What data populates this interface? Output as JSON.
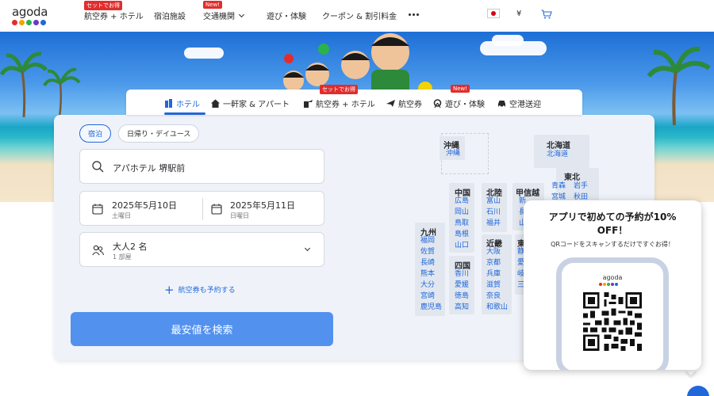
{
  "brand": {
    "logo_text": "agoda",
    "dot_colors": [
      "#e12d2d",
      "#f4a300",
      "#2bb24c",
      "#6f38c5",
      "#2067da"
    ]
  },
  "topnav": {
    "items": [
      {
        "label": "航空券 + ホテル",
        "badge": "セットでお得"
      },
      {
        "label": "宿泊施設"
      },
      {
        "label": "交通機関",
        "badge": "New!"
      },
      {
        "label": "遊び・体験"
      },
      {
        "label": "クーポン & 割引料金"
      }
    ],
    "currency": "¥"
  },
  "tabs": {
    "items": [
      {
        "label": "ホテル"
      },
      {
        "label": "一軒家 & アパート"
      },
      {
        "label": "航空券 + ホテル",
        "badge": "セットでお得"
      },
      {
        "label": "航空券"
      },
      {
        "label": "遊び・体験",
        "badge": "New!"
      },
      {
        "label": "空港送迎"
      }
    ]
  },
  "search": {
    "stay_types": [
      "宿泊",
      "日帰り・デイユース"
    ],
    "destination": "アパホテル 堺駅前",
    "checkin": {
      "date": "2025年5月10日",
      "weekday": "土曜日"
    },
    "checkout": {
      "date": "2025年5月11日",
      "weekday": "日曜日"
    },
    "guests": {
      "main": "大人2 名",
      "sub": "1 部屋"
    },
    "add_flight": "航空券も予約する",
    "submit": "最安値を検索"
  },
  "map": {
    "okinawa": {
      "title": "沖縄",
      "cities": [
        "沖縄"
      ]
    },
    "hokkaido": {
      "title": "北海道",
      "cities": [
        "北海道"
      ]
    },
    "tohoku": {
      "title": "東北",
      "cities": [
        "青森",
        "岩手",
        "宮城",
        "秋田"
      ]
    },
    "chugoku": {
      "title": "中国",
      "cities": [
        "広島",
        "岡山",
        "鳥取",
        "島根",
        "山口"
      ]
    },
    "hokuriku": {
      "title": "北陸",
      "cities": [
        "富山",
        "石川",
        "福井"
      ]
    },
    "koshinetsu": {
      "title": "甲信越",
      "cities": [
        "新",
        "長",
        "山"
      ]
    },
    "kyushu": {
      "title": "九州",
      "cities": [
        "福岡",
        "佐賀",
        "長崎",
        "熊本",
        "大分",
        "宮崎",
        "鹿児島"
      ]
    },
    "shikoku": {
      "title": "四国",
      "cities": [
        "香川",
        "愛媛",
        "徳島",
        "高知"
      ]
    },
    "kinki": {
      "title": "近畿",
      "cities": [
        "大阪",
        "京都",
        "兵庫",
        "滋賀",
        "奈良",
        "和歌山"
      ]
    },
    "kanto": {
      "title": "東",
      "cities": [
        "静",
        "愛",
        "岐",
        "三"
      ]
    }
  },
  "qr_popup": {
    "title_line1": "アプリで初めての予約が10%",
    "title_line2": "OFF！",
    "subtitle": "QRコードをスキャンするだけですぐお得！",
    "phone_logo": "agoda"
  },
  "colors": {
    "accent": "#2067da",
    "button": "#5391ef",
    "badge": "#e12d2d",
    "panel": "#eff3f9"
  }
}
